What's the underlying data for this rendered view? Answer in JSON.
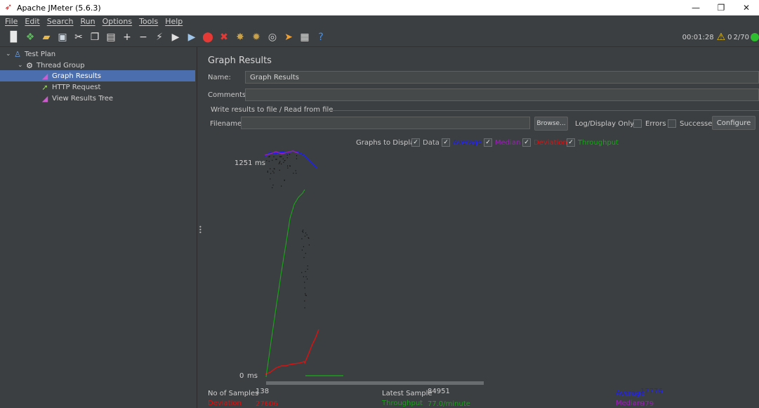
{
  "window": {
    "title": "Apache JMeter (5.6.3)",
    "minimize": "—",
    "restore": "❐",
    "close": "✕"
  },
  "menu": [
    "File",
    "Edit",
    "Search",
    "Run",
    "Options",
    "Tools",
    "Help"
  ],
  "toolbar": {
    "timer": "00:01:28",
    "warnings": "0",
    "threads": "2/70"
  },
  "tree": {
    "test_plan": "Test Plan",
    "thread_group": "Thread Group",
    "graph_results": "Graph Results",
    "http_request": "HTTP Request",
    "view_results_tree": "View Results Tree"
  },
  "panel": {
    "title": "Graph Results",
    "name_label": "Name:",
    "name_value": "Graph Results",
    "comments_label": "Comments:",
    "comments_value": "",
    "file_group_label": "Write results to file / Read from file",
    "filename_label": "Filename",
    "filename_value": "",
    "browse": "Browse...",
    "log_display_only": "Log/Display Only:",
    "errors": "Errors",
    "successes": "Successes",
    "configure": "Configure"
  },
  "graphs_to_display": {
    "label": "Graphs to Display",
    "options": [
      {
        "label": "Data",
        "color": "#bbbbbb",
        "checked": true
      },
      {
        "label": "Average",
        "color": "#1a1aff",
        "checked": true
      },
      {
        "label": "Median",
        "color": "#9a1fb8",
        "checked": true
      },
      {
        "label": "Deviation",
        "color": "#e01010",
        "checked": true
      },
      {
        "label": "Throughput",
        "color": "#1aa11a",
        "checked": true
      }
    ]
  },
  "chart_data": {
    "type": "line",
    "y_top_label": "1251",
    "y_bottom_label": "0",
    "y_unit": "ms",
    "ylim": [
      0,
      1251
    ]
  },
  "stats": {
    "no_of_samples_label": "No of Samples",
    "no_of_samples": "138",
    "latest_sample_label": "Latest Sample",
    "latest_sample": "84951",
    "average_label": "Average",
    "average": "17776",
    "deviation_label": "Deviation",
    "deviation": "27606",
    "throughput_label": "Throughput",
    "throughput": "77.0/minute",
    "median_label": "Median",
    "median": "979"
  },
  "colors": {
    "data": "#bbbbbb",
    "average": "#1a1aff",
    "median": "#9a1fb8",
    "deviation": "#e01010",
    "throughput": "#1aa11a",
    "selection": "#4b6eaf"
  }
}
